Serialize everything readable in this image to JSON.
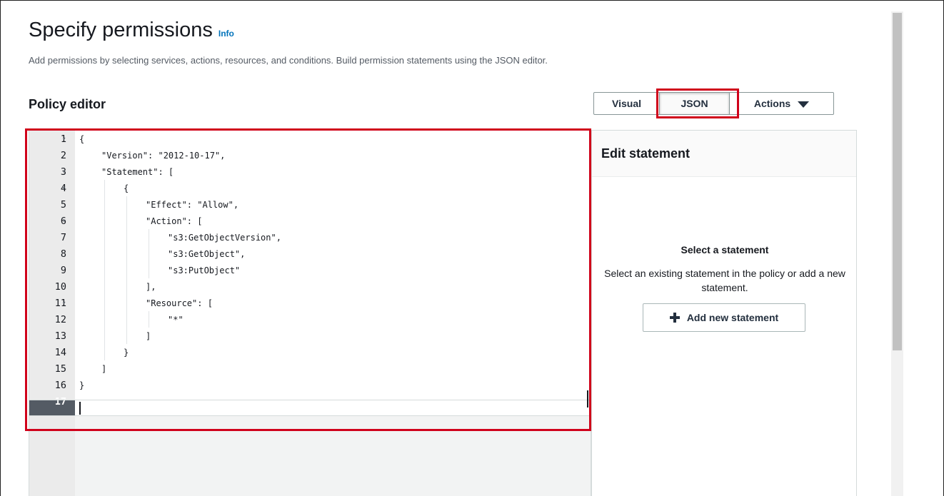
{
  "header": {
    "title": "Specify permissions",
    "info_link": "Info",
    "description": "Add permissions by selecting services, actions, resources, and conditions. Build permission statements using the JSON editor."
  },
  "policy_editor": {
    "title": "Policy editor",
    "tabs": {
      "visual": "Visual",
      "json": "JSON",
      "actions": "Actions"
    },
    "selected_tab": "JSON",
    "active_line": "17",
    "lines": [
      {
        "num": "1",
        "text": "{",
        "fold": true,
        "indent": 0
      },
      {
        "num": "2",
        "text": "\"Version\": \"2012-10-17\",",
        "fold": false,
        "indent": 1
      },
      {
        "num": "3",
        "text": "\"Statement\": [",
        "fold": true,
        "indent": 1
      },
      {
        "num": "4",
        "text": "{",
        "fold": true,
        "indent": 2
      },
      {
        "num": "5",
        "text": "\"Effect\": \"Allow\",",
        "fold": false,
        "indent": 3
      },
      {
        "num": "6",
        "text": "\"Action\": [",
        "fold": true,
        "indent": 3
      },
      {
        "num": "7",
        "text": "\"s3:GetObjectVersion\",",
        "fold": false,
        "indent": 4
      },
      {
        "num": "8",
        "text": "\"s3:GetObject\",",
        "fold": false,
        "indent": 4
      },
      {
        "num": "9",
        "text": "\"s3:PutObject\"",
        "fold": false,
        "indent": 4
      },
      {
        "num": "10",
        "text": "],",
        "fold": false,
        "indent": 3
      },
      {
        "num": "11",
        "text": "\"Resource\": [",
        "fold": true,
        "indent": 3
      },
      {
        "num": "12",
        "text": "\"*\"",
        "fold": false,
        "indent": 4
      },
      {
        "num": "13",
        "text": "]",
        "fold": false,
        "indent": 3
      },
      {
        "num": "14",
        "text": "}",
        "fold": false,
        "indent": 2
      },
      {
        "num": "15",
        "text": "]",
        "fold": false,
        "indent": 1
      },
      {
        "num": "16",
        "text": "}",
        "fold": false,
        "indent": 0
      },
      {
        "num": "17",
        "text": "",
        "fold": false,
        "indent": 0
      }
    ]
  },
  "edit_statement": {
    "title": "Edit statement",
    "empty_title": "Select a statement",
    "empty_description": "Select an existing statement in the policy or add a new statement.",
    "add_button": "Add new statement"
  },
  "colors": {
    "highlight": "#d0021b",
    "link": "#0073bb"
  }
}
